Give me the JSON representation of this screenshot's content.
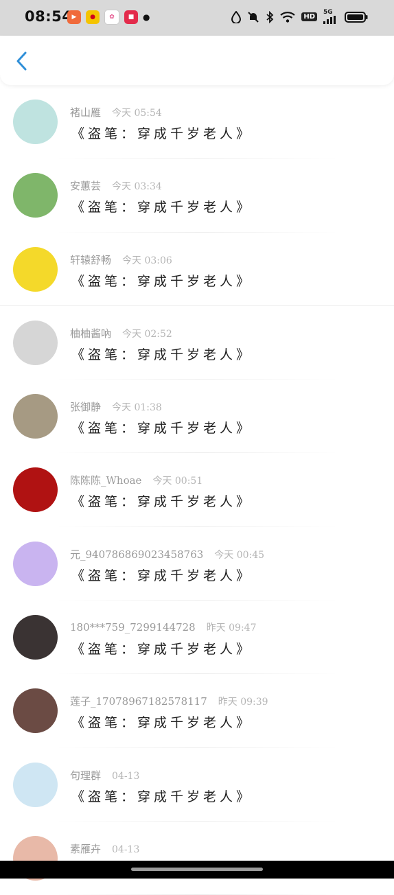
{
  "status_bar": {
    "time": "08:54",
    "hd": "HD",
    "network": "5G"
  },
  "header": {
    "back_label": "返回"
  },
  "comments": [
    {
      "name": "褚山雁",
      "time": "今天 05:54",
      "text": "《盗笔：穿成千岁老人》",
      "avatar_color": "#bfe3e0"
    },
    {
      "name": "安蕙芸",
      "time": "今天 03:34",
      "text": "《盗笔：穿成千岁老人》",
      "avatar_color": "#7fb66a"
    },
    {
      "name": "轩辕舒畅",
      "time": "今天 03:06",
      "text": "《盗笔：穿成千岁老人》",
      "avatar_color": "#f4d92a"
    },
    {
      "name": "柚柚酱吶",
      "time": "今天 02:52",
      "text": "《盗笔：穿成千岁老人》",
      "avatar_color": "#d6d6d6"
    },
    {
      "name": "张御静",
      "time": "今天 01:38",
      "text": "《盗笔：穿成千岁老人》",
      "avatar_color": "#a69a83"
    },
    {
      "name": "陈陈陈_Whoae",
      "time": "今天 00:51",
      "text": "《盗笔：穿成千岁老人》",
      "avatar_color": "#b01212"
    },
    {
      "name": "元_940786869023458763",
      "time": "今天 00:45",
      "text": "《盗笔：穿成千岁老人》",
      "avatar_color": "#c9b4f0"
    },
    {
      "name": "180***759_7299144728",
      "time": "昨天 09:47",
      "text": "《盗笔：穿成千岁老人》",
      "avatar_color": "#3a3333"
    },
    {
      "name": "莲子_17078967182578117",
      "time": "昨天 09:39",
      "text": "《盗笔：穿成千岁老人》",
      "avatar_color": "#6b4b44"
    },
    {
      "name": "句理群",
      "time": "04-13",
      "text": "《盗笔：穿成千岁老人》",
      "avatar_color": "#cfe6f3"
    },
    {
      "name": "素雁卉",
      "time": "04-13",
      "text": "",
      "avatar_color": "#e8b9a8"
    }
  ]
}
